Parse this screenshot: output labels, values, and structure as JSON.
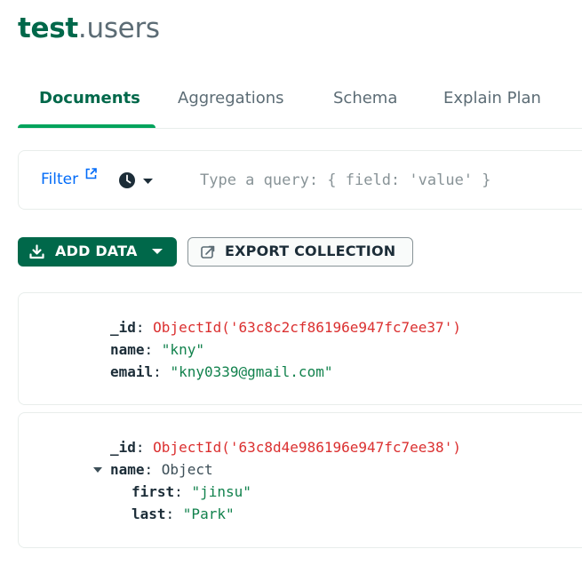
{
  "header": {
    "db": "test",
    "separator": ".",
    "collection": "users"
  },
  "tabs": [
    {
      "label": "Documents",
      "active": true
    },
    {
      "label": "Aggregations",
      "active": false
    },
    {
      "label": "Schema",
      "active": false
    },
    {
      "label": "Explain Plan",
      "active": false
    }
  ],
  "filter": {
    "label": "Filter",
    "link_icon": "external-link-icon",
    "history_icon": "clock-icon",
    "placeholder": "Type a query: { field: 'value' }"
  },
  "toolbar": {
    "add_data_label": "ADD DATA",
    "add_data_icon": "download-icon",
    "export_label": "EXPORT COLLECTION",
    "export_icon": "export-icon"
  },
  "documents": [
    {
      "id_key": "_id",
      "id_value": "ObjectId('63c8c2cf86196e947fc7ee37')",
      "fields": [
        {
          "key": "name",
          "value": "\"kny\""
        },
        {
          "key": "email",
          "value": "\"kny0339@gmail.com\""
        }
      ]
    },
    {
      "id_key": "_id",
      "id_value": "ObjectId('63c8d4e986196e947fc7ee38')",
      "object_key": "name",
      "object_type": "Object",
      "nested": [
        {
          "key": "first",
          "value": "\"jinsu\""
        },
        {
          "key": "last",
          "value": "\"Park\""
        }
      ]
    }
  ],
  "colors": {
    "brand_green": "#00684a",
    "tab_underline": "#00a35c",
    "link_blue": "#016bf8",
    "objectid_red": "#db3030",
    "string_green": "#12824d"
  }
}
